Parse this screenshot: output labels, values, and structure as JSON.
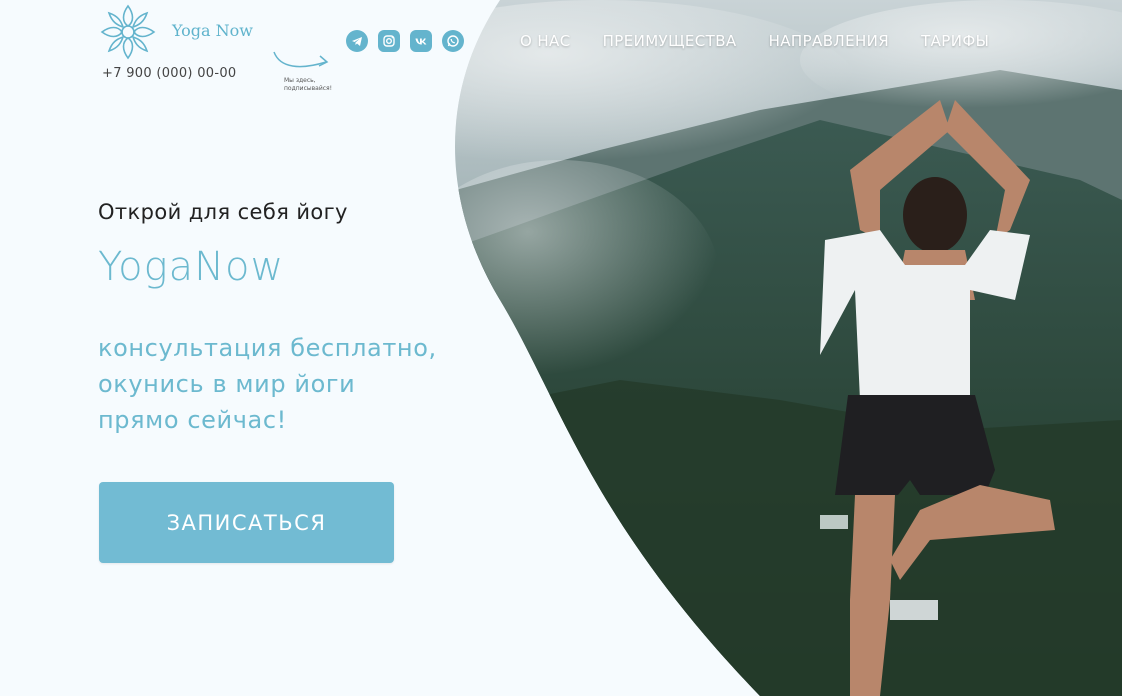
{
  "header": {
    "logo_text": "Yoga Now",
    "phone": "+7 900 (000) 00-00",
    "social_icons": [
      "telegram-icon",
      "instagram-icon",
      "vk-icon",
      "whatsapp-icon"
    ],
    "social_hint": "Мы здесь, подписывайся!"
  },
  "nav": {
    "items": [
      "О НАС",
      "ПРЕИМУЩЕСТВА",
      "НАПРАВЛЕНИЯ",
      "ТАРИФЫ"
    ]
  },
  "hero": {
    "tagline": "Открой для себя йогу",
    "brand": "YogaNow",
    "pitch_lines": [
      "консультация бесплатно,",
      "окунись в мир йоги",
      "прямо сейчас!"
    ],
    "cta_label": "ЗАПИСАТЬСЯ"
  },
  "colors": {
    "accent": "#6cb9cf",
    "button": "#72bbd3",
    "background": "#f6fbfe"
  }
}
